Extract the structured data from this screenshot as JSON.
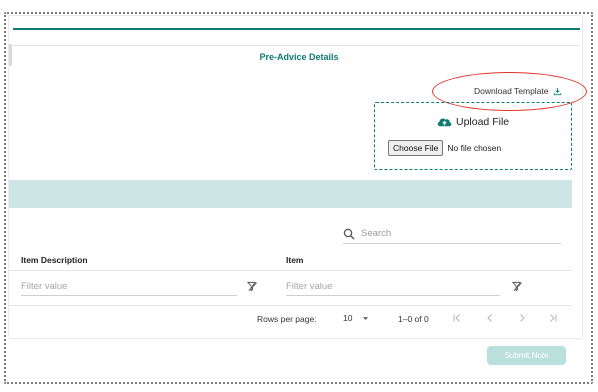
{
  "form": {
    "title": "Pre-Advice Details",
    "download_template_label": "Download Template",
    "upload": {
      "title": "Upload File",
      "choose_button": "Choose File",
      "no_file_text": "No file chosen"
    }
  },
  "table": {
    "search_placeholder": "Search",
    "columns": [
      {
        "label": "Item Description",
        "filter_placeholder": "Filter value"
      },
      {
        "label": "Item",
        "filter_placeholder": "Filter value"
      }
    ]
  },
  "paginator": {
    "rows_per_page_label": "Rows per page:",
    "rows_per_page_value": "10",
    "range_label": "1–0 of 0"
  },
  "actions": {
    "submit_label": "Submit Note"
  },
  "colors": {
    "accent_teal": "#0f7b73",
    "band_teal_light": "#cde6e5",
    "annotation_red": "#e2342b",
    "submit_disabled": "#b9e0db"
  },
  "icons": {
    "download": "download-icon",
    "upload": "cloud-upload-icon",
    "search": "search-icon",
    "filter_clear": "filter-clear-icon",
    "first_page": "first-page-icon",
    "prev_page": "chevron-left-icon",
    "next_page": "chevron-right-icon",
    "last_page": "last-page-icon",
    "dropdown": "caret-down-icon"
  }
}
